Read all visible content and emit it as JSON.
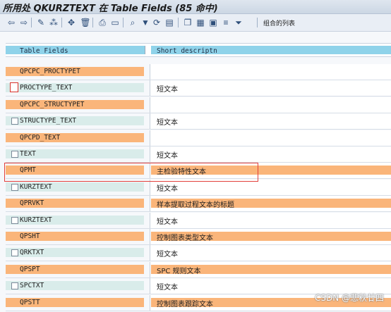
{
  "window": {
    "title": "所用处 QKURZTEXT 在 Table Fields (85 命中)"
  },
  "toolbar": {
    "buttons": [
      {
        "name": "back-arrow-icon",
        "glyph": "⇦"
      },
      {
        "name": "forward-arrow-icon",
        "glyph": "⇨"
      },
      {
        "name": "edit-pencil-icon",
        "glyph": "✎"
      },
      {
        "name": "display-change-icon",
        "glyph": "⁂"
      },
      {
        "name": "move-icon",
        "glyph": "✥"
      },
      {
        "name": "delete-icon",
        "glyph": "🗑"
      },
      {
        "name": "print-icon",
        "glyph": "⎙"
      },
      {
        "name": "window-icon",
        "glyph": "▭"
      },
      {
        "name": "find-icon",
        "glyph": "⌕"
      },
      {
        "name": "filter-icon",
        "glyph": "▼"
      },
      {
        "name": "refresh-icon",
        "glyph": "⟳"
      },
      {
        "name": "export-icon",
        "glyph": "▤"
      },
      {
        "name": "copy-icon",
        "glyph": "❐"
      },
      {
        "name": "paste-icon",
        "glyph": "▦"
      },
      {
        "name": "save-icon",
        "glyph": "▣"
      },
      {
        "name": "sort-icon",
        "glyph": "≡"
      },
      {
        "name": "funnel-icon",
        "glyph": "⏷"
      }
    ],
    "combined_list_label": "组合的列表"
  },
  "table": {
    "header": {
      "col1": "Table Fields",
      "col2": "Short descriptn"
    },
    "rows": [
      {
        "kind": "table",
        "name": "QPCPC_PROCTYPET",
        "desc": ""
      },
      {
        "kind": "field",
        "name": "PROCTYPE_TEXT",
        "desc": "短文本",
        "checkbox": "red"
      },
      {
        "kind": "table",
        "name": "QPCPC_STRUCTYPET",
        "desc": ""
      },
      {
        "kind": "field",
        "name": "STRUCTYPE_TEXT",
        "desc": "短文本",
        "checkbox": "normal"
      },
      {
        "kind": "table",
        "name": "QPCPD_TEXT",
        "desc": ""
      },
      {
        "kind": "field",
        "name": "TEXT",
        "desc": "短文本",
        "checkbox": "normal"
      },
      {
        "kind": "table",
        "name": "QPMT",
        "desc": "主检验特性文本"
      },
      {
        "kind": "field",
        "name": "KURZTEXT",
        "desc": "短文本",
        "checkbox": "normal"
      },
      {
        "kind": "table",
        "name": "QPRVKT",
        "desc": "样本提取过程文本的标题"
      },
      {
        "kind": "field",
        "name": "KURZTEXT",
        "desc": "短文本",
        "checkbox": "normal"
      },
      {
        "kind": "table",
        "name": "QPSHT",
        "desc": "控制图表类型文本"
      },
      {
        "kind": "field",
        "name": "QRKTXT",
        "desc": "短文本",
        "checkbox": "normal"
      },
      {
        "kind": "table",
        "name": "QPSPT",
        "desc": "SPC 规则文本"
      },
      {
        "kind": "field",
        "name": "SPCTXT",
        "desc": "短文本",
        "checkbox": "normal"
      },
      {
        "kind": "table",
        "name": "QPSTT",
        "desc": "控制图表跟踪文本"
      }
    ]
  },
  "watermark": "CSDN @悲秋廿四",
  "colors": {
    "table_row": "#fab57a",
    "field_row": "#d9ecea",
    "header": "#8fd3ea",
    "highlight": "#e2403c"
  }
}
